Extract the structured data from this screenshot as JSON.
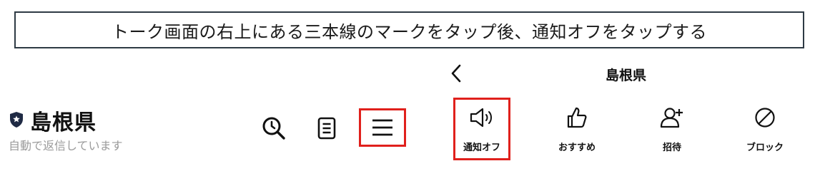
{
  "instruction": {
    "text": "トーク画面の右上にある三本線のマークをタップ後、通知オフをタップする"
  },
  "chat_header": {
    "account_name": "島根県",
    "status_text": "自動で返信しています",
    "icons": {
      "account": "shield-icon",
      "search": "search-icon",
      "notes": "notes-icon",
      "menu": "hamburger-menu-icon"
    }
  },
  "chat_menu": {
    "title": "島根県",
    "back_icon": "chevron-left-icon",
    "items": [
      {
        "label": "通知オフ",
        "icon": "speaker-icon"
      },
      {
        "label": "おすすめ",
        "icon": "thumbs-up-icon"
      },
      {
        "label": "招待",
        "icon": "add-person-icon"
      },
      {
        "label": "ブロック",
        "icon": "block-icon"
      }
    ]
  },
  "colors": {
    "highlight": "#e0201c",
    "banner_border": "#2e3a44",
    "secondary_text": "#9a9a9a"
  }
}
